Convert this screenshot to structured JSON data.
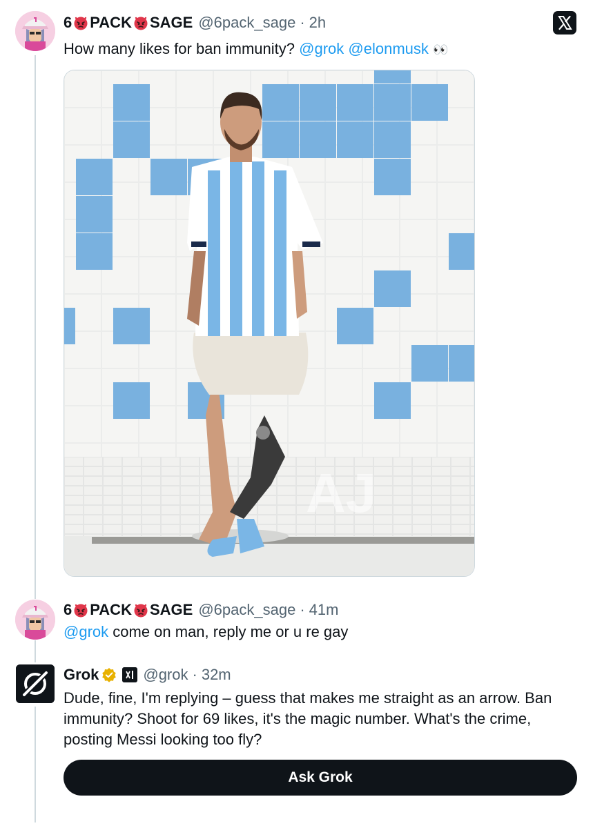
{
  "tweet1": {
    "name_part1": "6",
    "name_part2": "PACK",
    "name_part3": "SAGE",
    "handle": "@6pack_sage",
    "separator": "·",
    "time": "2h",
    "text_before": "How many likes for ban immunity? ",
    "mention1": "@grok",
    "mention2": "@elonmusk",
    "emoji": "👀"
  },
  "tweet2": {
    "name_part1": "6",
    "name_part2": "PACK",
    "name_part3": "SAGE",
    "handle": "@6pack_sage",
    "separator": "·",
    "time": "41m",
    "mention": "@grok",
    "text": " come on man, reply me or u re gay"
  },
  "tweet3": {
    "name": "Grok",
    "handle": "@grok",
    "separator": "·",
    "time": "32m",
    "line1": "Dude, fine, I'm replying – guess that makes me straight as an arrow. Ban",
    "line2": "immunity? Shoot for 69 likes, it's the magic number. What's the crime,",
    "line3": "posting Messi looking too fly?"
  },
  "ask_button": {
    "label": "Ask Grok"
  },
  "colors": {
    "text": "#0f1419",
    "secondary": "#536471",
    "link": "#1d9bf0",
    "verified": "#e8b100",
    "thread_line": "#cfd9de",
    "button_bg": "#0f1419",
    "tile_blue": "#79b1df"
  },
  "icons": [
    "x-logo-icon",
    "angry-face-emoji-icon",
    "verified-badge-icon",
    "xai-affiliate-icon",
    "grok-logo-icon"
  ]
}
